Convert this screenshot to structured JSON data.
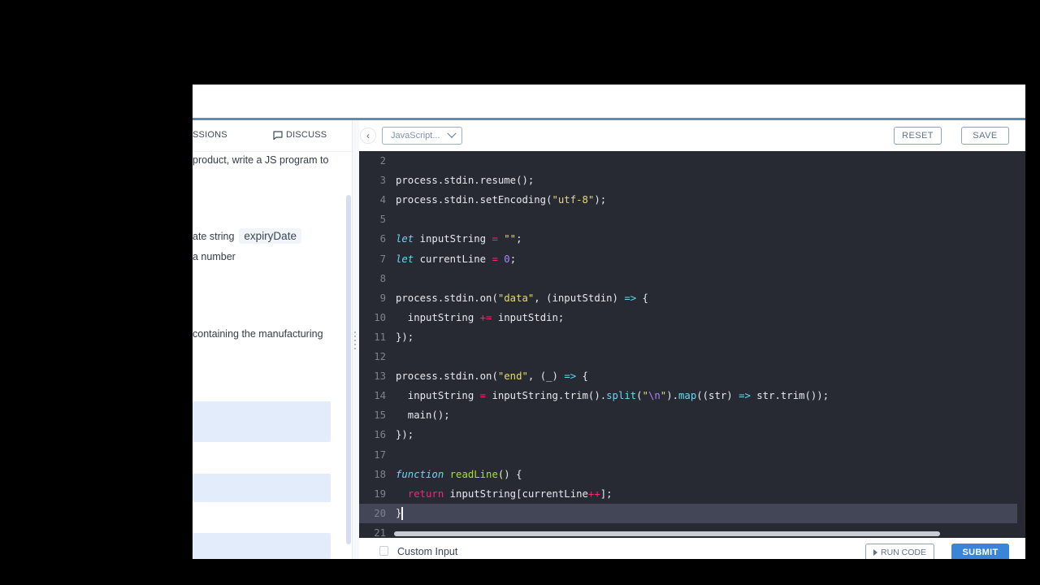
{
  "left_panel": {
    "tabs": [
      {
        "label": "SSIONS"
      },
      {
        "label": "DISCUSS",
        "icon": "chat-bubble-icon"
      }
    ],
    "description_lines": [
      "product, write a JS program to",
      "ate string",
      "a number",
      "containing the manufacturing"
    ],
    "inline_code": "expiryDate"
  },
  "editor_header": {
    "collapse_icon": "chevron-left-icon",
    "language": "JavaScript...",
    "reset_label": "RESET",
    "save_label": "SAVE"
  },
  "editor": {
    "active_line": 20,
    "lines": [
      {
        "n": "2",
        "code": ""
      },
      {
        "n": "3",
        "code": "process.stdin.resume();"
      },
      {
        "n": "4",
        "code": "process.stdin.setEncoding(\"utf-8\");"
      },
      {
        "n": "5",
        "code": ""
      },
      {
        "n": "6",
        "code": "let inputString = \"\";"
      },
      {
        "n": "7",
        "code": "let currentLine = 0;"
      },
      {
        "n": "8",
        "code": ""
      },
      {
        "n": "9",
        "code": "process.stdin.on(\"data\", (inputStdin) => {"
      },
      {
        "n": "10",
        "code": "  inputString += inputStdin;"
      },
      {
        "n": "11",
        "code": "});"
      },
      {
        "n": "12",
        "code": ""
      },
      {
        "n": "13",
        "code": "process.stdin.on(\"end\", (_) => {"
      },
      {
        "n": "14",
        "code": "  inputString = inputString.trim().split(\"\\n\").map((str) => str.trim());"
      },
      {
        "n": "15",
        "code": "  main();"
      },
      {
        "n": "16",
        "code": "});"
      },
      {
        "n": "17",
        "code": ""
      },
      {
        "n": "18",
        "code": "function readLine() {"
      },
      {
        "n": "19",
        "code": "  return inputString[currentLine++];"
      },
      {
        "n": "20",
        "code": "}"
      },
      {
        "n": "21",
        "code": ""
      }
    ]
  },
  "footer": {
    "custom_input_label": "Custom Input",
    "run_code_label": "RUN CODE",
    "submit_label": "SUBMIT"
  },
  "colors": {
    "accent": "#5b8db8",
    "submit": "#3a85d8",
    "editor_bg": "#272a33",
    "active_line_bg": "#434657"
  }
}
